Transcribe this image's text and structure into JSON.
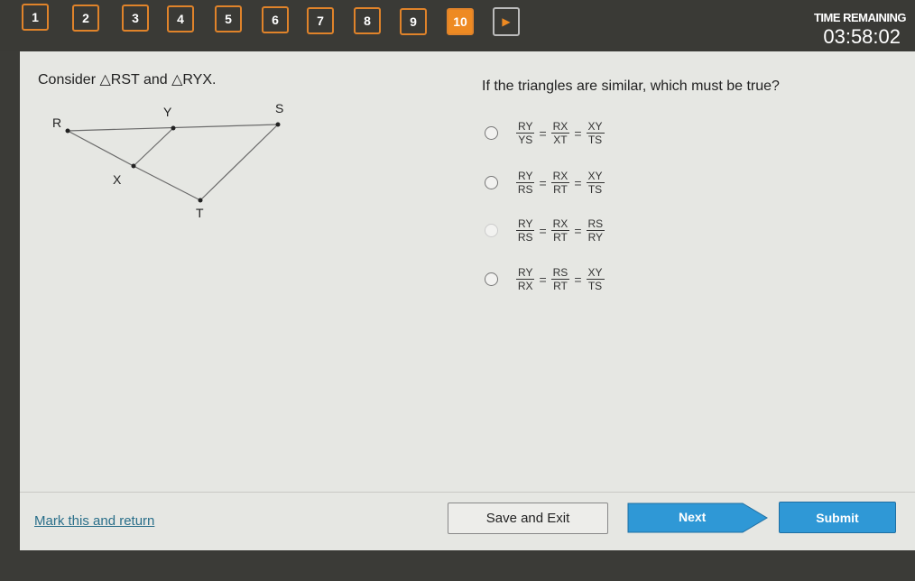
{
  "nav": {
    "questions": [
      "1",
      "2",
      "3",
      "4",
      "5",
      "6",
      "7",
      "8",
      "9",
      "10"
    ],
    "current": "10",
    "next_icon": "play-arrow-icon"
  },
  "timer": {
    "label": "TIME REMAINING",
    "value": "03:58:02"
  },
  "question": {
    "left_prompt": "Consider △RST and △RYX.",
    "right_prompt": "If the triangles are similar, which must be true?",
    "diagram_labels": {
      "R": "R",
      "Y": "Y",
      "S": "S",
      "X": "X",
      "T": "T"
    },
    "options": [
      [
        [
          "RY",
          "YS"
        ],
        [
          "RX",
          "XT"
        ],
        [
          "XY",
          "TS"
        ]
      ],
      [
        [
          "RY",
          "RS"
        ],
        [
          "RX",
          "RT"
        ],
        [
          "XY",
          "TS"
        ]
      ],
      [
        [
          "RY",
          "RS"
        ],
        [
          "RX",
          "RT"
        ],
        [
          "RS",
          "RY"
        ]
      ],
      [
        [
          "RY",
          "RX"
        ],
        [
          "RS",
          "RT"
        ],
        [
          "XY",
          "TS"
        ]
      ]
    ],
    "eq": "="
  },
  "footer": {
    "mark": "Mark this and return",
    "save": "Save and Exit",
    "next": "Next",
    "submit": "Submit"
  },
  "colors": {
    "accent": "#ee8a22",
    "button": "#2f98d6"
  }
}
